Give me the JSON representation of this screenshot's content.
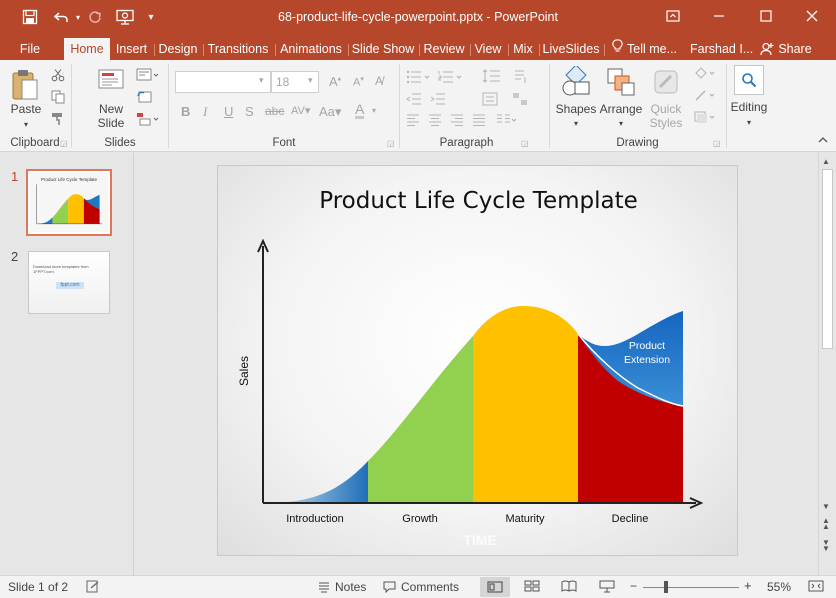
{
  "window": {
    "title": "68-product-life-cycle-powerpoint.pptx - PowerPoint",
    "brand_color": "#b7472a"
  },
  "tabs": [
    "File",
    "Home",
    "Insert",
    "Design",
    "Transitions",
    "Animations",
    "Slide Show",
    "Review",
    "View",
    "Mix",
    "LiveSlides"
  ],
  "active_tab": "Home",
  "tell_me": "Tell me...",
  "user": "Farshad I...",
  "share": "Share",
  "ribbon": {
    "paste": "Paste",
    "new_slide_1": "New",
    "new_slide_2": "Slide",
    "font_size": "18",
    "shapes": "Shapes",
    "arrange": "Arrange",
    "quick_styles_1": "Quick",
    "quick_styles_2": "Styles",
    "editing": "Editing",
    "groups": {
      "clipboard": "Clipboard",
      "slides": "Slides",
      "font": "Font",
      "paragraph": "Paragraph",
      "drawing": "Drawing"
    }
  },
  "thumbnails": [
    {
      "number": "1",
      "title": "Product Life Cycle Template"
    },
    {
      "number": "2",
      "line": "Download more templates from 1FPPT.com",
      "link": "fppt.com"
    }
  ],
  "slide": {
    "title": "Product Life Cycle Template",
    "y_axis_label": "Sales",
    "x_axis_label": "TIME",
    "annotation_1": "Product",
    "annotation_2": "Extension",
    "stages": [
      {
        "label": "Introduction",
        "color": "#1f78c1"
      },
      {
        "label": "Growth",
        "color": "#92d050"
      },
      {
        "label": "Maturity",
        "color": "#ffc000"
      },
      {
        "label": "Decline",
        "color": "#c00000"
      }
    ]
  },
  "status": {
    "slide_indicator": "Slide 1 of 2",
    "notes": "Notes",
    "comments": "Comments",
    "zoom": "55%"
  }
}
